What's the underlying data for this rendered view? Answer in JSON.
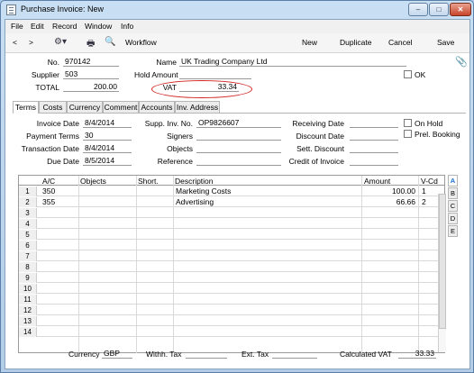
{
  "window": {
    "title": "Purchase Invoice: New",
    "min": "–",
    "max": "□",
    "close": "✕"
  },
  "menu": [
    "File",
    "Edit",
    "Record",
    "Window",
    "Info"
  ],
  "toolbar": {
    "back": "<",
    "forward": ">",
    "workflow": "Workflow",
    "new": "New",
    "duplicate": "Duplicate",
    "cancel": "Cancel",
    "save": "Save"
  },
  "header": {
    "no_label": "No.",
    "no": "970142",
    "name_label": "Name",
    "name": "UK Trading Company Ltd",
    "supplier_label": "Supplier",
    "supplier": "503",
    "hold_label": "Hold Amount",
    "ok_label": "OK",
    "total_label": "TOTAL",
    "total": "200.00",
    "vat_label": "VAT",
    "vat": "33.34"
  },
  "tabs": [
    "Terms",
    "Costs",
    "Currency",
    "Comment",
    "Accounts",
    "Inv. Address"
  ],
  "terms": {
    "invoice_date_label": "Invoice Date",
    "invoice_date": "8/4/2014",
    "payment_terms_label": "Payment Terms",
    "payment_terms": "30",
    "transaction_date_label": "Transaction Date",
    "transaction_date": "8/4/2014",
    "due_date_label": "Due Date",
    "due_date": "8/5/2014",
    "supp_inv_label": "Supp. Inv. No.",
    "supp_inv": "OP9826607",
    "signers_label": "Signers",
    "objects_label": "Objects",
    "reference_label": "Reference",
    "receiving_label": "Receiving Date",
    "discount_label": "Discount Date",
    "sett_label": "Sett. Discount",
    "credit_label": "Credit of Invoice",
    "on_hold_label": "On Hold",
    "prel_label": "Prel. Booking"
  },
  "grid": {
    "headers": {
      "ac": "A/C",
      "objects": "Objects",
      "short": "Short.",
      "description": "Description",
      "amount": "Amount",
      "vcd": "V-Cd"
    },
    "rows": [
      {
        "n": "1",
        "ac": "350",
        "description": "Marketing Costs",
        "amount": "100.00",
        "vcd": "1"
      },
      {
        "n": "2",
        "ac": "355",
        "description": "Advertising",
        "amount": "66.66",
        "vcd": "2"
      },
      {
        "n": "3"
      },
      {
        "n": "4"
      },
      {
        "n": "5"
      },
      {
        "n": "6"
      },
      {
        "n": "7"
      },
      {
        "n": "8"
      },
      {
        "n": "9"
      },
      {
        "n": "10"
      },
      {
        "n": "11"
      },
      {
        "n": "12"
      },
      {
        "n": "13"
      },
      {
        "n": "14"
      }
    ],
    "side_tabs": [
      "A",
      "B",
      "C",
      "D",
      "E"
    ]
  },
  "footer": {
    "currency_label": "Currency",
    "currency": "GBP",
    "withh_label": "Withh. Tax",
    "ext_label": "Ext. Tax",
    "calc_vat_label": "Calculated VAT",
    "calc_vat": "33.33"
  }
}
